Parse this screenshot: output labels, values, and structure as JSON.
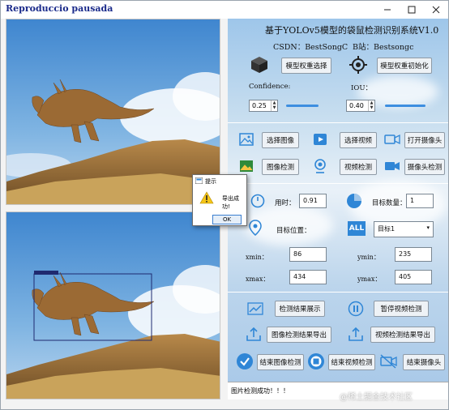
{
  "window": {
    "title": "Reproduccio pausada"
  },
  "header": {
    "title": "基于YOLOv5模型的袋鼠检测识别系统V1.0",
    "csdn": "CSDN：BestSongC",
    "bili": "B站：Bestsongc"
  },
  "model": {
    "select_label": "模型权重选择",
    "init_label": "模型权重初始化"
  },
  "params": {
    "confidence_label": "Confidence:",
    "confidence_value": "0.25",
    "iou_label": "IOU：",
    "iou_value": "0.40"
  },
  "actions": {
    "select_image": "选择图像",
    "select_video": "选择视频",
    "open_camera": "打开摄像头",
    "image_detect": "图像检测",
    "video_detect": "视频检测",
    "camera_detect": "摄像头检测"
  },
  "results": {
    "time_label": "用时：",
    "time_value": "0.91",
    "count_label": "目标数量：",
    "count_value": "1",
    "position_label": "目标位置：",
    "target_select": "目标1",
    "xmin_label": "xmin：",
    "xmin_value": "86",
    "ymin_label": "ymin：",
    "ymin_value": "235",
    "xmax_label": "xmax：",
    "xmax_value": "434",
    "ymax_label": "ymax：",
    "ymax_value": "405"
  },
  "bottom": {
    "show_results": "检测结果展示",
    "pause_video": "暂停视频检测",
    "export_image": "图像检测结果导出",
    "export_video": "视频检测结果导出",
    "end_image": "结束图像检测",
    "end_video": "结束视频检测",
    "end_camera": "结束摄像头"
  },
  "status": {
    "message": "图片检测成功！！！"
  },
  "dialog": {
    "title": "提示",
    "message": "导出成功!",
    "ok": "OK"
  },
  "watermark": "@稀土掘金技术社区",
  "colors": {
    "accent": "#3d8ee0",
    "icon_blue": "#2f86d6",
    "bbox": "#1f2a70"
  }
}
